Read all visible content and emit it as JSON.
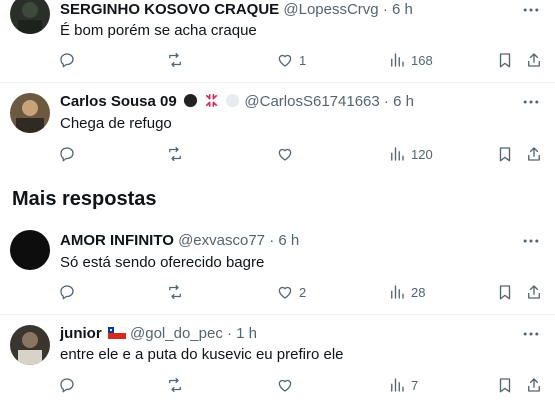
{
  "tweets": [
    {
      "name": "SERGINHO KOSOVO CRAQUE",
      "handle": "@LopessCrvg",
      "dot": "·",
      "time": "6 h",
      "text": "É bom porém se acha craque",
      "replies": "",
      "retweets": "",
      "likes": "1",
      "views": "168"
    },
    {
      "name": "Carlos Sousa 09",
      "handle": "@CarlosS61741663",
      "dot": "·",
      "time": "6 h",
      "text": "Chega de refugo",
      "replies": "",
      "retweets": "",
      "likes": "",
      "views": "120"
    },
    {
      "name": "AMOR INFINITO",
      "handle": "@exvasco77",
      "dot": "·",
      "time": "6 h",
      "text": "Só está sendo oferecido bagre",
      "replies": "",
      "retweets": "",
      "likes": "2",
      "views": "28"
    },
    {
      "name": "junior",
      "handle": "@gol_do_pec",
      "dot": "·",
      "time": "1 h",
      "text": "entre ele e a puta do kusevic eu prefiro ele",
      "replies": "",
      "retweets": "",
      "likes": "",
      "views": "7"
    }
  ],
  "section": {
    "title": "Mais respostas"
  },
  "colors": {
    "text": "#0f1419",
    "muted": "#536471",
    "divider": "#eff3f4"
  },
  "icons": [
    "more-icon",
    "reply-icon",
    "retweet-icon",
    "like-icon",
    "views-icon",
    "bookmark-icon",
    "share-icon"
  ]
}
